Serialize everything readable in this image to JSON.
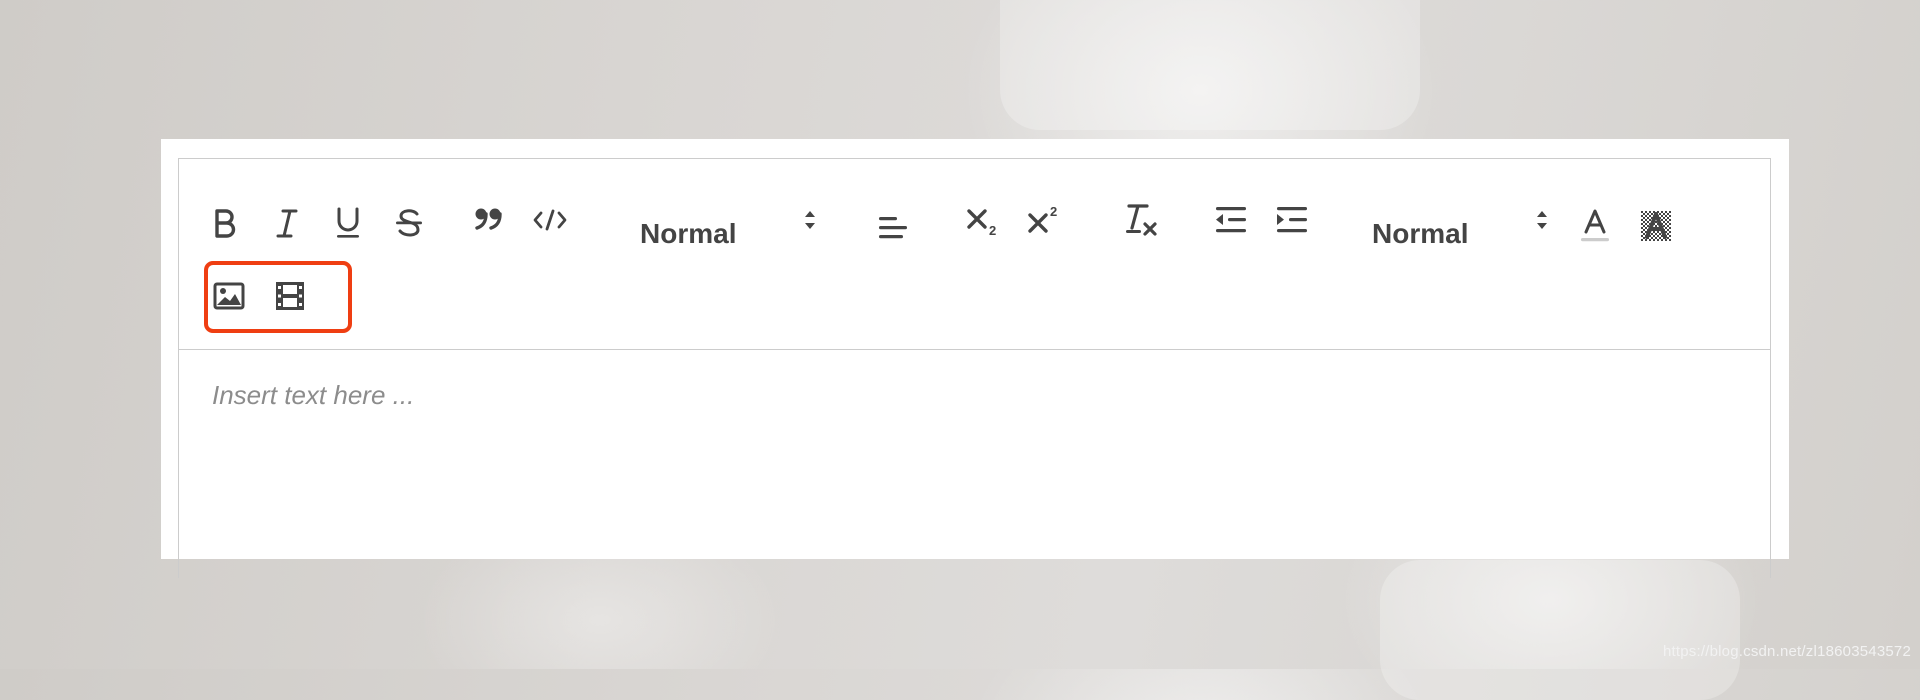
{
  "toolbar": {
    "buttons": {
      "bold": "bold-icon",
      "italic": "italic-icon",
      "underline": "underline-icon",
      "strike": "strikethrough-icon",
      "blockquote": "blockquote-icon",
      "code_block": "code-icon",
      "align": "align-left-icon",
      "subscript": "subscript-icon",
      "superscript": "superscript-icon",
      "clean": "clear-format-icon",
      "indent_decrease": "outdent-icon",
      "indent_increase": "indent-icon",
      "color": "font-color-icon",
      "background": "background-color-icon",
      "image": "image-icon",
      "video": "video-icon"
    },
    "header_picker": {
      "label": "Normal"
    },
    "size_picker": {
      "label": "Normal"
    }
  },
  "editor": {
    "placeholder": "Insert text here ..."
  },
  "highlight_color": "#ef3e12",
  "watermark": "https://blog.csdn.net/zl18603543572"
}
